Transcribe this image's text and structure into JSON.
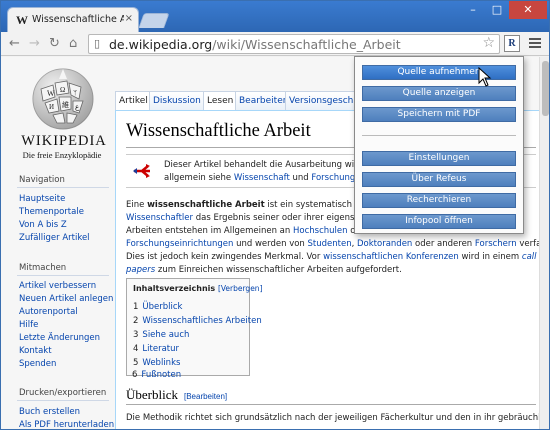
{
  "browser": {
    "tab_favicon": "W",
    "tab_title": "Wissenschaftliche Arbeit – Wikipedia",
    "tab_close": "×",
    "url_domain": "de.wikipedia.org",
    "url_path": "/wiki/Wissenschaftliche_Arbeit",
    "extension_label": "R",
    "icons": [
      "back-icon",
      "forward-icon",
      "reload-icon",
      "home-icon",
      "page-icon",
      "star-icon",
      "menu-icon"
    ]
  },
  "sidebar": {
    "logo_name": "Wikipedia",
    "slogan": "Die freie Enzyklopädie",
    "navigation_heading": "Navigation",
    "navigation": [
      "Hauptseite",
      "Themenportale",
      "Von A bis Z",
      "Zufälliger Artikel"
    ],
    "mitmachen_heading": "Mitmachen",
    "mitmachen": [
      "Artikel verbessern",
      "Neuen Artikel anlegen",
      "Autorenportal",
      "Hilfe",
      "Letzte Änderungen",
      "Kontakt",
      "Spenden"
    ],
    "drucken_heading": "Drucken/exportieren",
    "drucken": [
      "Buch erstellen",
      "Als PDF herunterladen"
    ]
  },
  "page_tabs": [
    "Artikel",
    "Diskussion",
    "Lesen",
    "Bearbeiten",
    "Versionsgeschichte"
  ],
  "article": {
    "title": "Wissenschaftliche Arbeit",
    "hatnote": {
      "line1": "Dieser Artikel behandelt die Ausarbeitung wissenschaftlicher",
      "line2_pre": "allgemein siehe ",
      "link1": "Wissenschaft",
      "and": " und ",
      "link2": "Forschung",
      "dot": "."
    },
    "lines": [
      {
        "a": "Eine ",
        "b": "wissenschaftliche Arbeit",
        "c": " ist ein systematisch geglie"
      },
      {
        "a": "Wissenschaftler",
        "b": " das Ergebnis seiner oder ihrer eigenständi"
      },
      {
        "a": "Arbeiten entstehen im Allgemeinen an ",
        "b": "Hochschulen",
        "c": " oder an"
      },
      {
        "a": "Forschungseinrichtungen",
        "b": " und werden von ",
        "c": "Studenten",
        ",d": ", ",
        "e": "Doktoranden",
        "f": " oder anderen ",
        "g": "Forschern",
        "h": " verfasst."
      },
      {
        "a": "Dies ist jedoch kein zwingendes Merkmal. Vor ",
        "b": "wissenschaftlichen Konferenzen",
        "c": " wird in einem ",
        "d": "call for"
      },
      {
        "a": "papers",
        "b": " zum Einreichen wissenschaftlicher Arbeiten aufgefordert."
      }
    ],
    "toc": {
      "title": "Inhaltsverzeichnis",
      "toggle": "[Verbergen]",
      "items": [
        {
          "num": "1",
          "label": "Überblick"
        },
        {
          "num": "2",
          "label": "Wissenschaftliches Arbeiten"
        },
        {
          "num": "3",
          "label": "Siehe auch"
        },
        {
          "num": "4",
          "label": "Literatur"
        },
        {
          "num": "5",
          "label": "Weblinks"
        },
        {
          "num": "6",
          "label": "Fußnoten"
        }
      ]
    },
    "section_heading": "Überblick",
    "section_edit": "[Bearbeiten]",
    "last_para": "Die Methodik richtet sich grundsätzlich nach der jeweiligen Fächerkultur und den in ihr gebräuchlichen"
  },
  "popup_menu": {
    "group1": [
      "Quelle aufnehmen",
      "Quelle anzeigen",
      "Speichern mit PDF"
    ],
    "group2": [
      "Einstellungen",
      "Über Refeus",
      "Recherchieren",
      "Infopool öffnen"
    ]
  }
}
